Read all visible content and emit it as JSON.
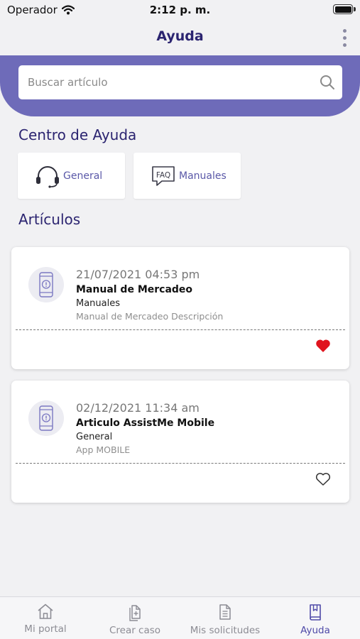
{
  "status_bar": {
    "carrier": "Operador",
    "time": "2:12 p. m."
  },
  "header": {
    "title": "Ayuda"
  },
  "search": {
    "placeholder": "Buscar artículo"
  },
  "help_center": {
    "title": "Centro de Ayuda",
    "tiles": [
      {
        "label": "General",
        "icon": "headset-icon"
      },
      {
        "label": "Manuales",
        "icon": "faq-icon"
      }
    ]
  },
  "articles": {
    "title": "Artículos",
    "items": [
      {
        "date": "21/07/2021 04:53 pm",
        "title": "Manual de Mercadeo",
        "category": "Manuales",
        "description": "Manual de Mercadeo Descripción",
        "favorite": true
      },
      {
        "date": "02/12/2021 11:34 am",
        "title": "Articulo AssistMe Mobile",
        "category": "General",
        "description": "App MOBILE",
        "favorite": false
      }
    ]
  },
  "tab_bar": {
    "items": [
      {
        "label": "Mi portal",
        "icon": "home-icon",
        "active": false
      },
      {
        "label": "Crear caso",
        "icon": "new-document-icon",
        "active": false
      },
      {
        "label": "Mis solicitudes",
        "icon": "document-list-icon",
        "active": false
      },
      {
        "label": "Ayuda",
        "icon": "book-icon",
        "active": true
      }
    ]
  },
  "colors": {
    "brand": "#2b2470",
    "accent": "#6e6bb9",
    "favorite": "#e0141e",
    "tab_active": "#4f4aa8"
  }
}
